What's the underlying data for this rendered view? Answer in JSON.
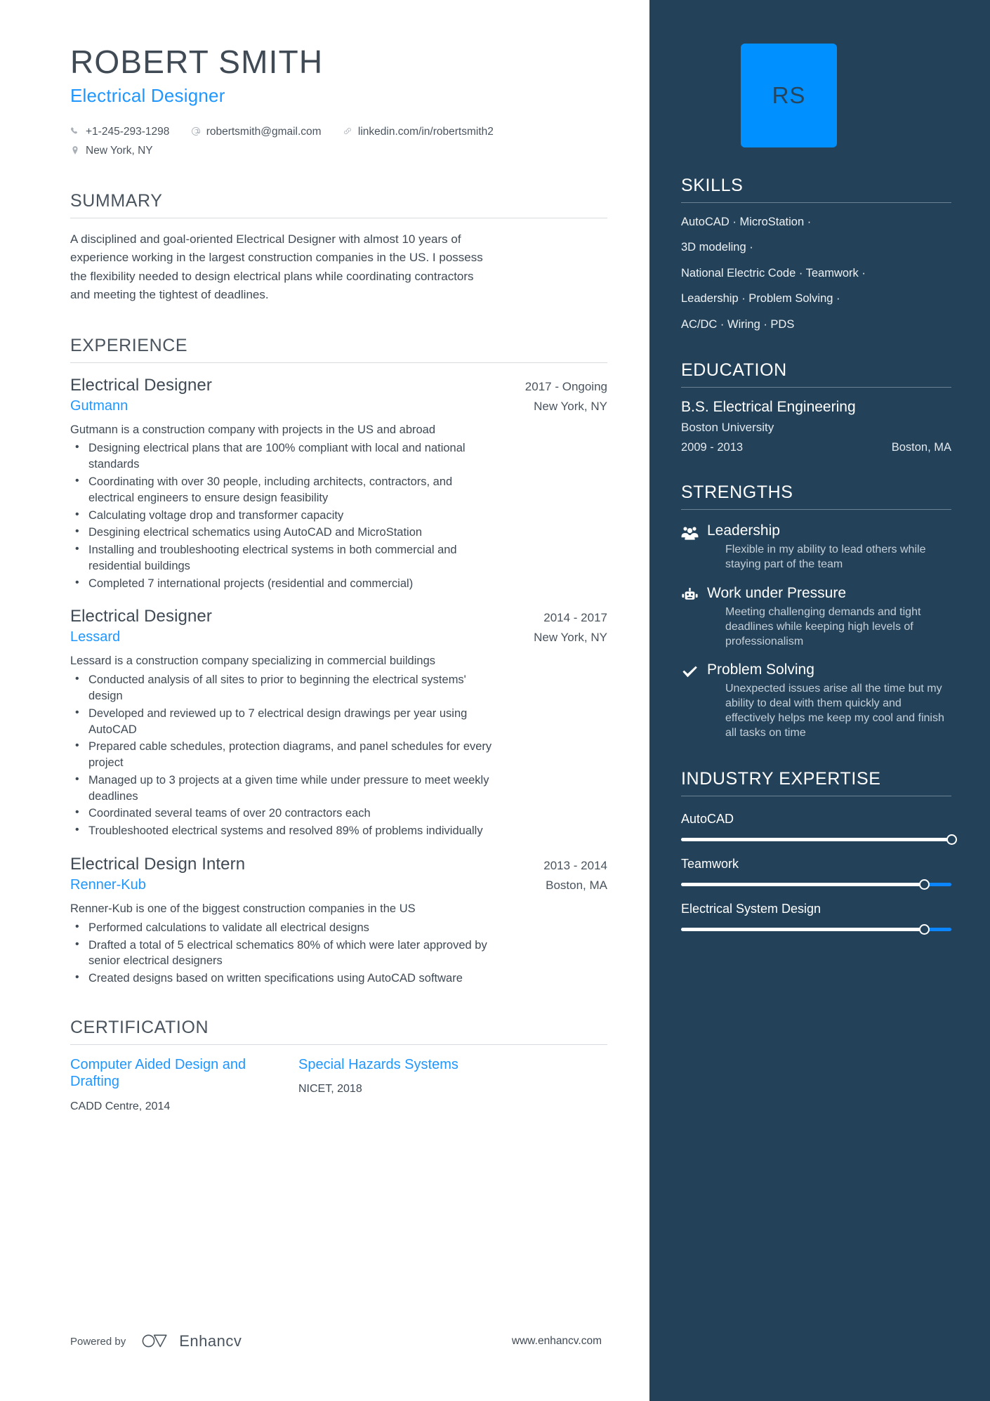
{
  "header": {
    "name": "ROBERT SMITH",
    "role": "Electrical Designer",
    "contacts": [
      {
        "icon": "phone-icon",
        "text": "+1-245-293-1298"
      },
      {
        "icon": "email-icon",
        "text": "robertsmith@gmail.com"
      },
      {
        "icon": "link-icon",
        "text": "linkedin.com/in/robertsmith2"
      },
      {
        "icon": "location-pin-icon",
        "text": "New York, NY"
      }
    ]
  },
  "summary": {
    "title": "SUMMARY",
    "text": "A disciplined and goal-oriented Electrical Designer with almost 10 years of experience working in the largest construction companies in the US. I possess the flexibility needed to design electrical plans while coordinating contractors and meeting the tightest of deadlines."
  },
  "experience": {
    "title": "EXPERIENCE",
    "jobs": [
      {
        "title": "Electrical Designer",
        "dates": "2017 - Ongoing",
        "company": "Gutmann",
        "location": "New York, NY",
        "description": "Gutmann is a construction company with projects in the US and abroad",
        "bullets": [
          "Designing electrical plans that are 100% compliant with local and national standards",
          "Coordinating with over 30 people, including architects, contractors, and electrical engineers to ensure design feasibility",
          "Calculating voltage drop and transformer capacity",
          "Desgining electrical schematics using AutoCAD and MicroStation",
          "Installing and troubleshooting electrical systems in both commercial and residential buildings",
          "Completed 7 international projects (residential and commercial)"
        ]
      },
      {
        "title": "Electrical Designer",
        "dates": "2014 - 2017",
        "company": "Lessard",
        "location": "New York, NY",
        "description": "Lessard is a construction company specializing in commercial buildings",
        "bullets": [
          "Conducted analysis of all sites to prior to beginning the electrical systems' design",
          "Developed and reviewed up to 7 electrical design drawings per year using AutoCAD",
          "Prepared cable schedules, protection diagrams, and panel schedules for every project",
          "Managed up to 3 projects at a given time while under pressure to meet weekly deadlines",
          "Coordinated several teams of over 20 contractors each",
          "Troubleshooted electrical systems and resolved 89% of problems individually"
        ]
      },
      {
        "title": "Electrical Design Intern",
        "dates": "2013 - 2014",
        "company": "Renner-Kub",
        "location": "Boston, MA",
        "description": "Renner-Kub is one of the biggest construction companies in the US",
        "bullets": [
          "Performed calculations to validate all electrical designs",
          "Drafted a total of 5 electrical schematics 80% of which were later approved by senior electrical designers",
          "Created designs based on written specifications using AutoCAD software"
        ]
      }
    ]
  },
  "certification": {
    "title": "CERTIFICATION",
    "items": [
      {
        "name": "Computer Aided Design and Drafting",
        "meta": "CADD Centre, 2014"
      },
      {
        "name": "Special Hazards Systems",
        "meta": "NICET, 2018"
      }
    ]
  },
  "footer": {
    "powered_by": "Powered by",
    "brand": "Enhancv",
    "site": "www.enhancv.com"
  },
  "sidebar": {
    "avatar_initials": "RS",
    "skills": {
      "title": "SKILLS",
      "lines": [
        "AutoCAD · MicroStation ·",
        "3D modeling ·",
        "National Electric Code · Teamwork ·",
        "Leadership · Problem Solving ·",
        "AC/DC · Wiring · PDS"
      ]
    },
    "education": {
      "title": "EDUCATION",
      "degree": "B.S. Electrical Engineering",
      "school": "Boston University",
      "dates": "2009 - 2013",
      "location": "Boston, MA"
    },
    "strengths": {
      "title": "STRENGTHS",
      "items": [
        {
          "icon": "users-group-icon",
          "name": "Leadership",
          "description": "Flexible in my ability to lead others while staying part of the team"
        },
        {
          "icon": "robot-icon",
          "name": "Work under Pressure",
          "description": "Meeting challenging demands and tight deadlines while keeping high levels of professionalism"
        },
        {
          "icon": "check-icon",
          "name": "Problem Solving",
          "description": "Unexpected issues arise all the time but my ability to deal with them quickly and effectively helps me keep my cool and finish all tasks on time"
        }
      ]
    },
    "expertise": {
      "title": "INDUSTRY EXPERTISE",
      "items": [
        {
          "label": "AutoCAD",
          "percent": 100
        },
        {
          "label": "Teamwork",
          "percent": 90
        },
        {
          "label": "Electrical System Design",
          "percent": 90
        }
      ]
    }
  },
  "colors": {
    "accent_blue": "#1f97ff",
    "sidebar_navy": "#234259",
    "avatar_blue": "#0090ff",
    "text_dark": "#3f4a55"
  }
}
